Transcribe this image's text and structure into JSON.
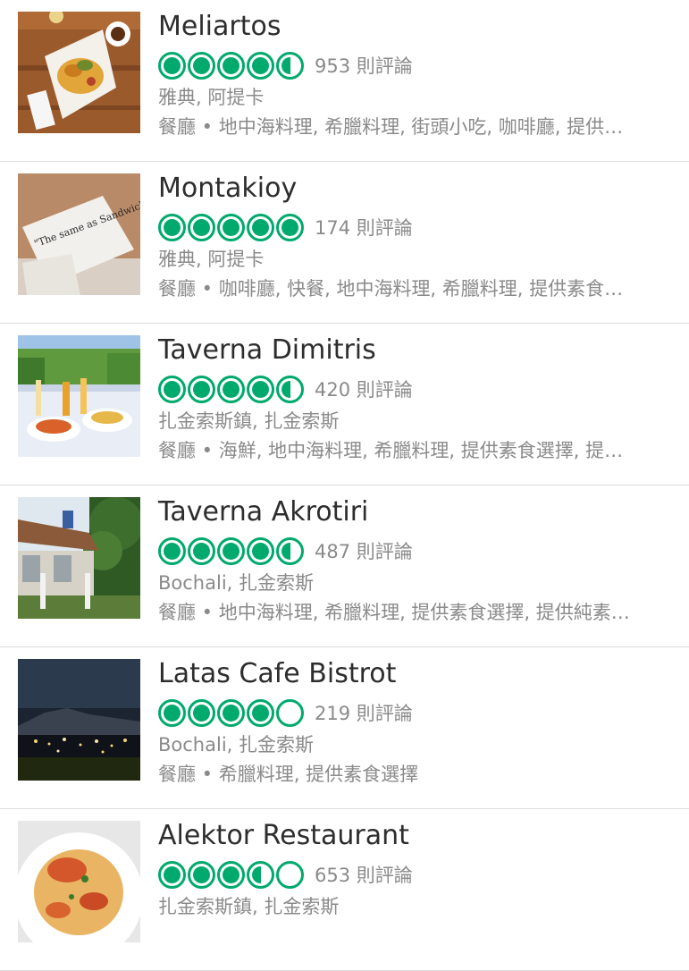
{
  "colors": {
    "rating_green": "#00aa6c",
    "secondary_text": "#8a8a8a",
    "title_text": "#2d2d2d"
  },
  "restaurants": [
    {
      "name": "Meliartos",
      "rating": 4.5,
      "bubbles": [
        "full",
        "full",
        "full",
        "full",
        "half"
      ],
      "reviews": "953 則評論",
      "location": "雅典, 阿提卡",
      "cuisine": "餐廳 • 地中海料理, 希臘料理, 街頭小吃, 咖啡廳, 提供…",
      "photo": "plate-of-food-photo"
    },
    {
      "name": "Montakioy",
      "rating": 5,
      "bubbles": [
        "full",
        "full",
        "full",
        "full",
        "full"
      ],
      "reviews": "174 則評論",
      "location": "雅典, 阿提卡",
      "cuisine": "餐廳 • 咖啡廳, 快餐, 地中海料理, 希臘料理, 提供素食…",
      "photo": "sandwich-paper-photo",
      "photo_text": "\"The same as Sandwich, please...\""
    },
    {
      "name": "Taverna Dimitris",
      "rating": 4.5,
      "bubbles": [
        "full",
        "full",
        "full",
        "full",
        "half"
      ],
      "reviews": "420 則評論",
      "location": "扎金索斯鎮, 扎金索斯",
      "cuisine": "餐廳 • 海鮮, 地中海料理, 希臘料理, 提供素食選擇, 提…",
      "photo": "outdoor-table-photo"
    },
    {
      "name": "Taverna Akrotiri",
      "rating": 4.5,
      "bubbles": [
        "full",
        "full",
        "full",
        "full",
        "half"
      ],
      "reviews": "487 則評論",
      "location": "Bochali, 扎金索斯",
      "cuisine": "餐廳 • 地中海料理, 希臘料理, 提供素食選擇, 提供純素…",
      "photo": "taverna-garden-photo"
    },
    {
      "name": "Latas Cafe Bistrot",
      "rating": 4,
      "bubbles": [
        "full",
        "full",
        "full",
        "full",
        "empty"
      ],
      "reviews": "219 則評論",
      "location": "Bochali, 扎金索斯",
      "cuisine": "餐廳 • 希臘料理, 提供素食選擇",
      "photo": "night-view-photo"
    },
    {
      "name": "Alektor Restaurant",
      "rating": 3.5,
      "bubbles": [
        "full",
        "full",
        "full",
        "half",
        "empty"
      ],
      "reviews": "653 則評論",
      "location": "扎金索斯鎮, 扎金索斯",
      "cuisine": "",
      "photo": "pasta-dish-photo"
    }
  ]
}
